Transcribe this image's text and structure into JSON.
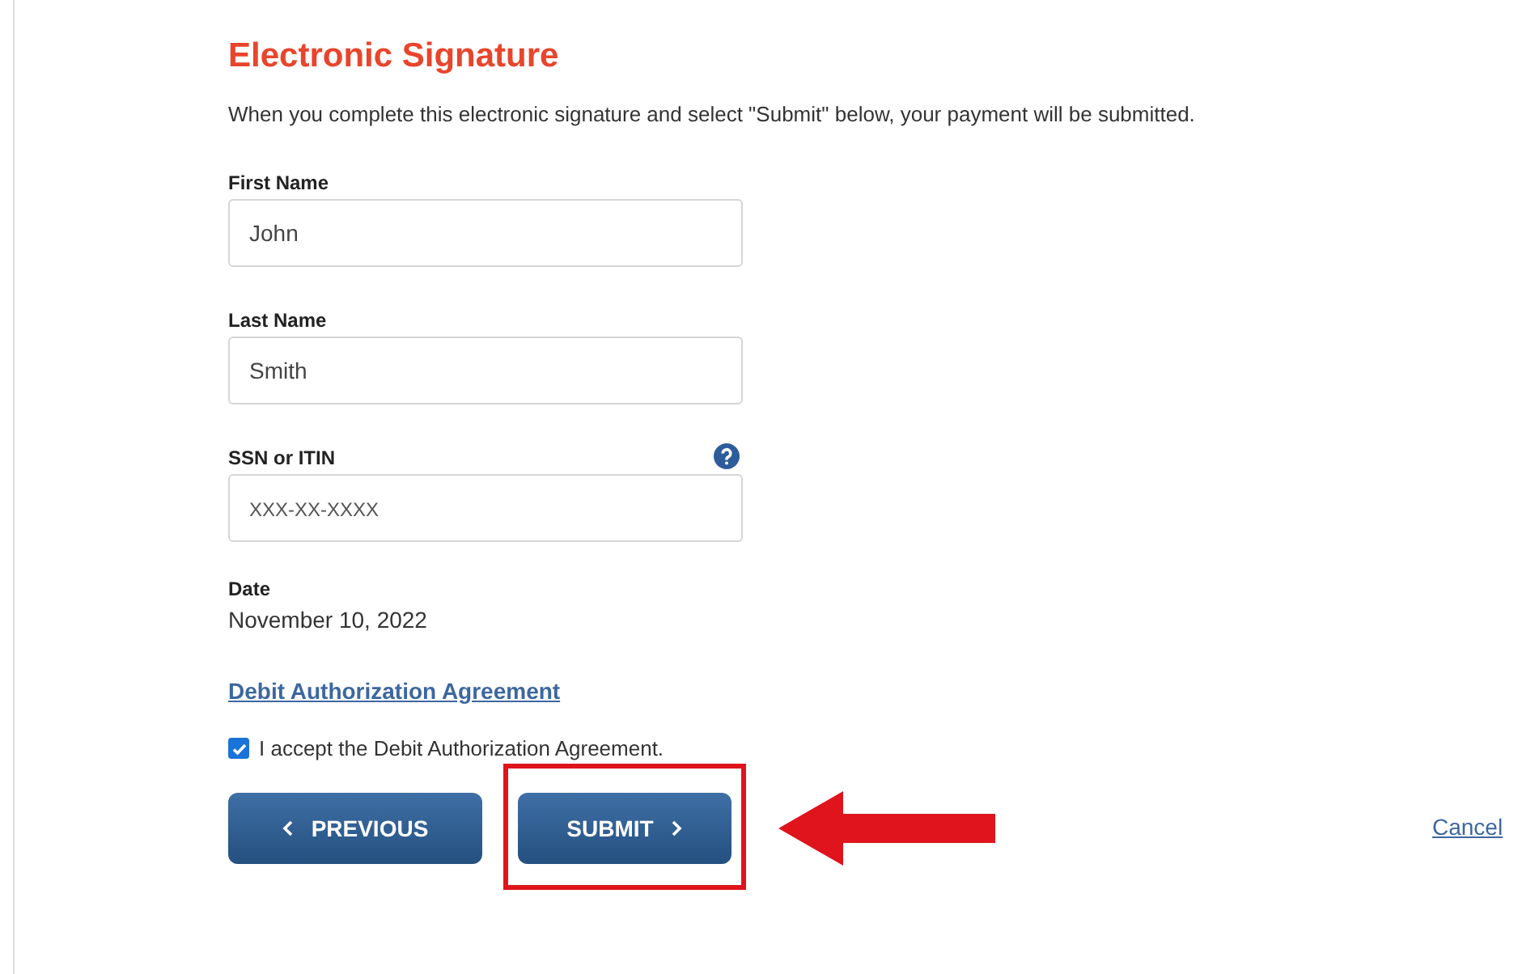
{
  "heading": "Electronic Signature",
  "intro": "When you complete this electronic signature and select \"Submit\" below, your payment will be submitted.",
  "fields": [
    {
      "label": "First Name",
      "value": "John",
      "help": false
    },
    {
      "label": "Last Name",
      "value": "Smith",
      "help": false
    },
    {
      "label": "SSN or ITIN",
      "placeholder": "XXX-XX-XXXX",
      "help": true
    }
  ],
  "date": {
    "label": "Date",
    "value": "November 10, 2022"
  },
  "agreement_link": "Debit Authorization Agreement",
  "accept": {
    "label": "I accept the Debit Authorization Agreement.",
    "checked": true
  },
  "buttons": [
    {
      "label": "PREVIOUS",
      "kind": "back"
    },
    {
      "label": "SUBMIT",
      "kind": "forward"
    }
  ],
  "cancel": "Cancel",
  "highlight_submit": true
}
